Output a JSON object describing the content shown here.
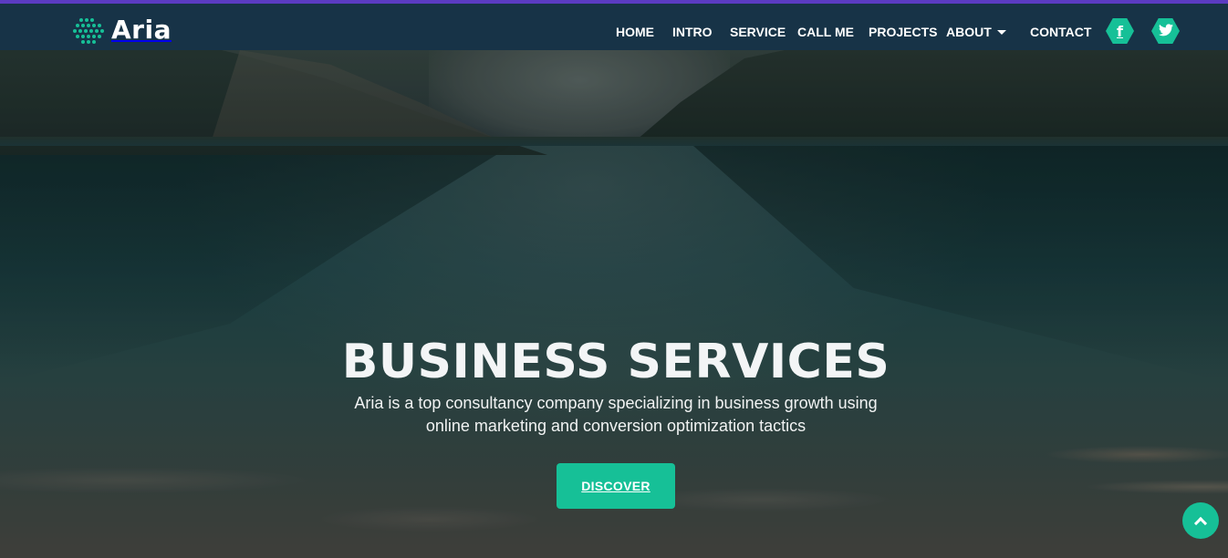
{
  "brand": {
    "name": "Aria",
    "accent_color": "#16c097",
    "top_strip_color": "#5b3bc2",
    "navbar_color": "#173347"
  },
  "nav": {
    "items": [
      {
        "label": "HOME"
      },
      {
        "label": "INTRO"
      },
      {
        "label": "SERVICE"
      },
      {
        "label": "CALL ME"
      },
      {
        "label": "PROJECTS"
      },
      {
        "label": "ABOUT",
        "dropdown": true
      },
      {
        "label": "CONTACT"
      }
    ],
    "social": [
      {
        "icon": "facebook-icon",
        "glyph": "f"
      },
      {
        "icon": "twitter-icon",
        "glyph": "t"
      }
    ]
  },
  "hero": {
    "title": "BUSINESS SERVICES",
    "subtitle": "Aria is a top consultancy company specializing in business growth using online marketing and conversion optimization tactics",
    "cta_label": "DISCOVER"
  },
  "back_to_top": {
    "icon": "chevron-up-icon"
  }
}
